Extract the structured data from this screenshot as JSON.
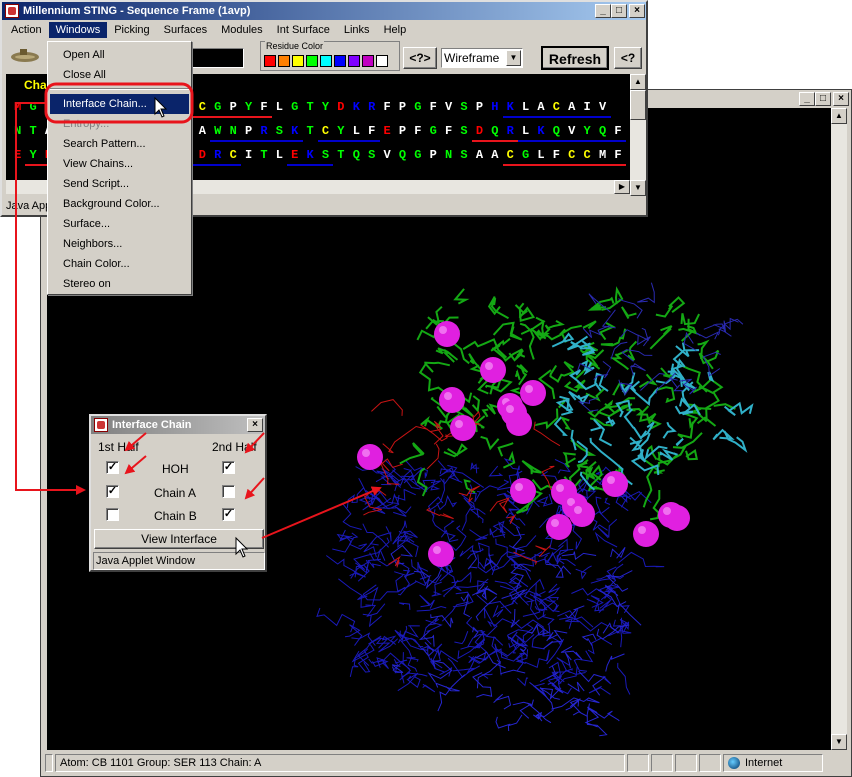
{
  "viewer": {
    "status": {
      "info": "Atom: CB 1101  Group: SER 113  Chain: A",
      "zone": "Internet"
    }
  },
  "seq_frame": {
    "title": "Millennium STING - Sequence Frame (1avp)",
    "menu": [
      "Action",
      "Windows",
      "Picking",
      "Surfaces",
      "Modules",
      "Int Surface",
      "Links",
      "Help"
    ],
    "residue_color_label": "Residue Color",
    "residue_colors": [
      "#ff0000",
      "#ff8000",
      "#ffff00",
      "#00ff00",
      "#00ffff",
      "#0000ff",
      "#8000ff",
      "#c000c0",
      "#ffffff"
    ],
    "help_btn": "<?>",
    "render_mode": "Wireframe",
    "refresh_btn": "Refresh",
    "help_btn2": "<?",
    "chain_label": "Cha",
    "sequence_rows": [
      [
        [
          "M",
          "#ff0000"
        ],
        [
          "G",
          "#00ff00"
        ],
        [
          "S",
          "#ffffff"
        ],
        [
          "",
          "#000"
        ],
        [
          "",
          "#000"
        ],
        [
          "",
          "#000"
        ],
        [
          "",
          "#000"
        ],
        [
          "",
          "#000"
        ],
        [
          "",
          "#000"
        ],
        [
          "",
          "#000"
        ],
        [
          "L",
          "#ffffff"
        ],
        [
          "G",
          "#00ff00"
        ],
        [
          "C",
          "#ffff00"
        ],
        [
          "G",
          "#00ff00"
        ],
        [
          "P",
          "#ffffff"
        ],
        [
          "Y",
          "#00ff00"
        ],
        [
          "F",
          "#ffffff"
        ],
        [
          "L",
          "#ffffff"
        ],
        [
          "G",
          "#00ff00"
        ],
        [
          "T",
          "#00ff00"
        ],
        [
          "Y",
          "#00ff00"
        ],
        [
          "D",
          "#ff0000"
        ],
        [
          "K",
          "#0000ff"
        ],
        [
          "R",
          "#0000ff"
        ],
        [
          "F",
          "#ffffff"
        ],
        [
          "P",
          "#ffffff"
        ],
        [
          "G",
          "#00ff00"
        ],
        [
          "F",
          "#ffffff"
        ],
        [
          "V",
          "#ffffff"
        ],
        [
          "S",
          "#00ff00"
        ],
        [
          "P",
          "#ffffff"
        ],
        [
          "H",
          "#0000ff"
        ],
        [
          "K",
          "#0000ff"
        ],
        [
          "L",
          "#ffffff"
        ],
        [
          "A",
          "#ffffff"
        ],
        [
          "C",
          "#ffff00"
        ],
        [
          "A",
          "#ffffff"
        ],
        [
          "I",
          "#ffffff"
        ],
        [
          "V",
          "#ffffff"
        ]
      ],
      [
        [
          "N",
          "#00ff00"
        ],
        [
          "T",
          "#00ff00"
        ],
        [
          "A",
          "#ffffff"
        ],
        [
          "",
          "#000"
        ],
        [
          "",
          "#000"
        ],
        [
          "",
          "#000"
        ],
        [
          "",
          "#000"
        ],
        [
          "",
          "#000"
        ],
        [
          "",
          "#000"
        ],
        [
          "",
          "#000"
        ],
        [
          "A",
          "#ffffff"
        ],
        [
          "F",
          "#ffffff"
        ],
        [
          "A",
          "#ffffff"
        ],
        [
          "W",
          "#00ff00"
        ],
        [
          "N",
          "#00ff00"
        ],
        [
          "P",
          "#ffffff"
        ],
        [
          "R",
          "#0000ff"
        ],
        [
          "S",
          "#00ff00"
        ],
        [
          "K",
          "#0000ff"
        ],
        [
          "T",
          "#00ff00"
        ],
        [
          "C",
          "#ffff00"
        ],
        [
          "Y",
          "#00ff00"
        ],
        [
          "L",
          "#ffffff"
        ],
        [
          "F",
          "#ffffff"
        ],
        [
          "E",
          "#ff0000"
        ],
        [
          "P",
          "#ffffff"
        ],
        [
          "F",
          "#ffffff"
        ],
        [
          "G",
          "#00ff00"
        ],
        [
          "F",
          "#ffffff"
        ],
        [
          "S",
          "#00ff00"
        ],
        [
          "D",
          "#ff0000"
        ],
        [
          "Q",
          "#00ff00"
        ],
        [
          "R",
          "#0000ff"
        ],
        [
          "L",
          "#ffffff"
        ],
        [
          "K",
          "#0000ff"
        ],
        [
          "Q",
          "#00ff00"
        ],
        [
          "V",
          "#ffffff"
        ],
        [
          "Y",
          "#00ff00"
        ],
        [
          "Q",
          "#00ff00"
        ],
        [
          "F",
          "#ffffff"
        ]
      ],
      [
        [
          "E",
          "#ff0000"
        ],
        [
          "Y",
          "#00ff00"
        ],
        [
          "E",
          "#ff0000"
        ],
        [
          "",
          "#000"
        ],
        [
          "",
          "#000"
        ],
        [
          "",
          "#000"
        ],
        [
          "",
          "#000"
        ],
        [
          "",
          "#000"
        ],
        [
          "",
          "#000"
        ],
        [
          "",
          "#000"
        ],
        [
          "S",
          "#00ff00"
        ],
        [
          "P",
          "#ffffff"
        ],
        [
          "D",
          "#ff0000"
        ],
        [
          "R",
          "#0000ff"
        ],
        [
          "C",
          "#ffff00"
        ],
        [
          "I",
          "#ffffff"
        ],
        [
          "T",
          "#00ff00"
        ],
        [
          "L",
          "#ffffff"
        ],
        [
          "E",
          "#ff0000"
        ],
        [
          "K",
          "#0000ff"
        ],
        [
          "S",
          "#00ff00"
        ],
        [
          "T",
          "#00ff00"
        ],
        [
          "Q",
          "#00ff00"
        ],
        [
          "S",
          "#00ff00"
        ],
        [
          "V",
          "#ffffff"
        ],
        [
          "Q",
          "#00ff00"
        ],
        [
          "G",
          "#00ff00"
        ],
        [
          "P",
          "#ffffff"
        ],
        [
          "N",
          "#00ff00"
        ],
        [
          "S",
          "#00ff00"
        ],
        [
          "A",
          "#ffffff"
        ],
        [
          "A",
          "#ffffff"
        ],
        [
          "C",
          "#ffff00"
        ],
        [
          "G",
          "#00ff00"
        ],
        [
          "L",
          "#ffffff"
        ],
        [
          "F",
          "#ffffff"
        ],
        [
          "C",
          "#ffff00"
        ],
        [
          "C",
          "#ffff00"
        ],
        [
          "M",
          "#ffffff"
        ],
        [
          "F",
          "#ffffff"
        ]
      ]
    ],
    "status": "Java Appl"
  },
  "windows_menu": {
    "items": [
      {
        "label": "Open All",
        "state": "normal"
      },
      {
        "label": "Close All",
        "state": "normal"
      },
      {
        "label": "Interface Chain...",
        "state": "selected"
      },
      {
        "label": "Entropy...",
        "state": "disabled"
      },
      {
        "label": "Search Pattern...",
        "state": "normal"
      },
      {
        "label": "View Chains...",
        "state": "normal"
      },
      {
        "label": "Send Script...",
        "state": "normal"
      },
      {
        "label": "Background Color...",
        "state": "normal"
      },
      {
        "label": "Surface...",
        "state": "normal"
      },
      {
        "label": "Neighbors...",
        "state": "normal"
      },
      {
        "label": "Chain Color...",
        "state": "normal"
      },
      {
        "label": "Stereo on",
        "state": "normal"
      }
    ]
  },
  "iface": {
    "title": "Interface Chain",
    "col1": "1st Half",
    "col2": "2nd Half",
    "rows": [
      {
        "label": "HOH",
        "first": true,
        "second": true
      },
      {
        "label": "Chain A",
        "first": true,
        "second": false
      },
      {
        "label": "Chain B",
        "first": false,
        "second": true
      }
    ],
    "view_btn": "View Interface",
    "status": "Java Applet Window"
  },
  "colors": {
    "highlight": "#0a246a",
    "annotation": "#e8141c",
    "sphere": "#e020e0"
  }
}
